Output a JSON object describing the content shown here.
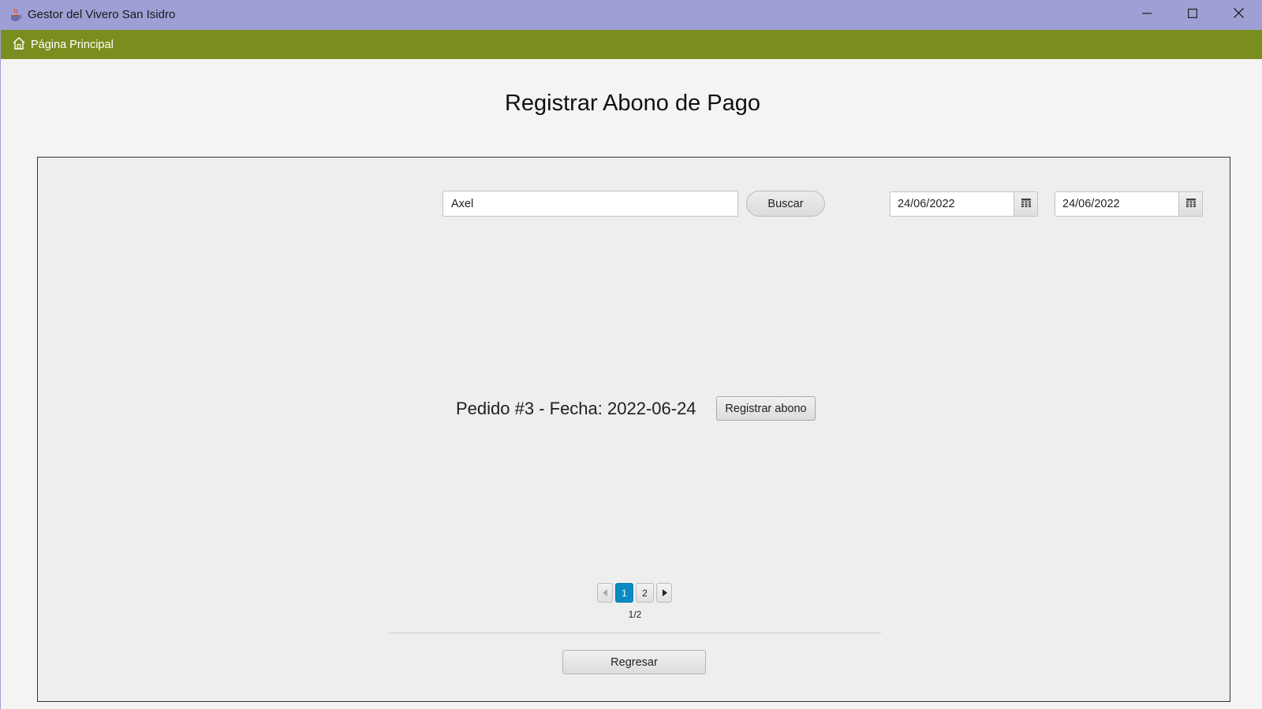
{
  "window": {
    "title": "Gestor del Vivero San Isidro",
    "icons": [
      "java-cup-icon",
      "minimize-icon",
      "maximize-icon",
      "close-icon"
    ]
  },
  "menu": {
    "home_label": "Página Principal",
    "home_icon": "home-icon"
  },
  "page": {
    "title": "Registrar Abono de Pago"
  },
  "search": {
    "value": "Axel",
    "button_label": "Buscar"
  },
  "date_filters": {
    "from": "24/06/2022",
    "to": "24/06/2022",
    "icon": "calendar-icon"
  },
  "order": {
    "text": "Pedido #3 - Fecha: 2022-06-24",
    "button_label": "Registrar abono"
  },
  "pagination": {
    "pages": [
      "1",
      "2"
    ],
    "current": "1",
    "info": "1/2",
    "active_color": "#0a8bc4"
  },
  "footer": {
    "back_label": "Regresar"
  },
  "colors": {
    "titlebar": "#9e9fd4",
    "menubar": "#7a8e1f"
  }
}
